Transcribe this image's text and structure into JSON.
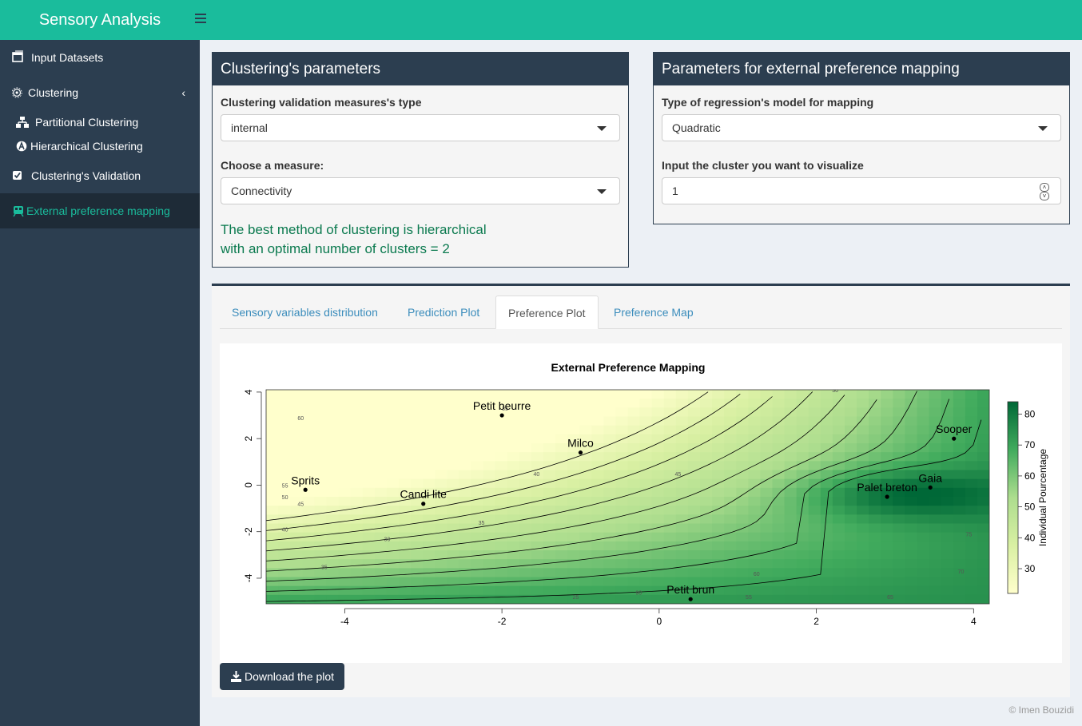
{
  "header": {
    "title": "Sensory Analysis"
  },
  "sidebar": {
    "items": [
      {
        "label": "Input Datasets",
        "icon": "table-icon"
      },
      {
        "label": "Clustering",
        "icon": "cogs-icon"
      },
      {
        "label": "Partitional Clustering",
        "icon": "sitemap-icon"
      },
      {
        "label": "Hierarchical Clustering",
        "icon": "hierarchy-icon"
      },
      {
        "label": "Clustering's Validation",
        "icon": "check-square-icon"
      },
      {
        "label": "External preference mapping",
        "icon": "map-icon"
      }
    ]
  },
  "clustering_box": {
    "title": "Clustering's parameters",
    "measure_type_label": "Clustering validation measures's type",
    "measure_type_value": "internal",
    "measure_label": "Choose a measure:",
    "measure_value": "Connectivity",
    "result_line1": "The best method of clustering is hierarchical",
    "result_line2": "with an optimal number of clusters = 2"
  },
  "mapping_box": {
    "title": "Parameters for external preference mapping",
    "model_label": "Type of regression's model for mapping",
    "model_value": "Quadratic",
    "cluster_label": "Input the cluster you want to visualize",
    "cluster_value": "1"
  },
  "tabs": [
    {
      "label": "Sensory variables distribution"
    },
    {
      "label": "Prediction Plot"
    },
    {
      "label": "Preference Plot",
      "active": true
    },
    {
      "label": "Preference Map"
    }
  ],
  "download_label": "Download the plot",
  "footer": "© Imen Bouzidi",
  "chart_data": {
    "type": "heatmap",
    "title": "External Preference Mapping",
    "xlim": [
      -5.0,
      4.2
    ],
    "ylim": [
      -5.1,
      4.1
    ],
    "x_ticks": [
      "-4",
      "-2",
      "0",
      "2",
      "4"
    ],
    "y_ticks": [
      "4",
      "2",
      "0",
      "-2",
      "-4"
    ],
    "colorbar": {
      "label": "Individual Pourcentage",
      "ticks": [
        "80",
        "70",
        "60",
        "50",
        "40",
        "30"
      ],
      "low_color": "#ffffcc",
      "high_color": "#006837"
    },
    "points": [
      {
        "label": "Petit beurre",
        "x": -2.0,
        "y": 3.0
      },
      {
        "label": "Milco",
        "x": -1.0,
        "y": 1.4
      },
      {
        "label": "Sooper",
        "x": 3.75,
        "y": 2.0
      },
      {
        "label": "Sprits",
        "x": -4.5,
        "y": -0.2
      },
      {
        "label": "Candi lite",
        "x": -3.0,
        "y": -0.8
      },
      {
        "label": "Palet breton",
        "x": 2.9,
        "y": -0.5
      },
      {
        "label": "Gaia",
        "x": 3.45,
        "y": -0.1
      },
      {
        "label": "Petit brun",
        "x": 0.4,
        "y": -4.9
      }
    ],
    "contour_labels": [
      "30",
      "35",
      "40",
      "45",
      "50",
      "55",
      "60",
      "65",
      "70",
      "75",
      "25"
    ]
  }
}
